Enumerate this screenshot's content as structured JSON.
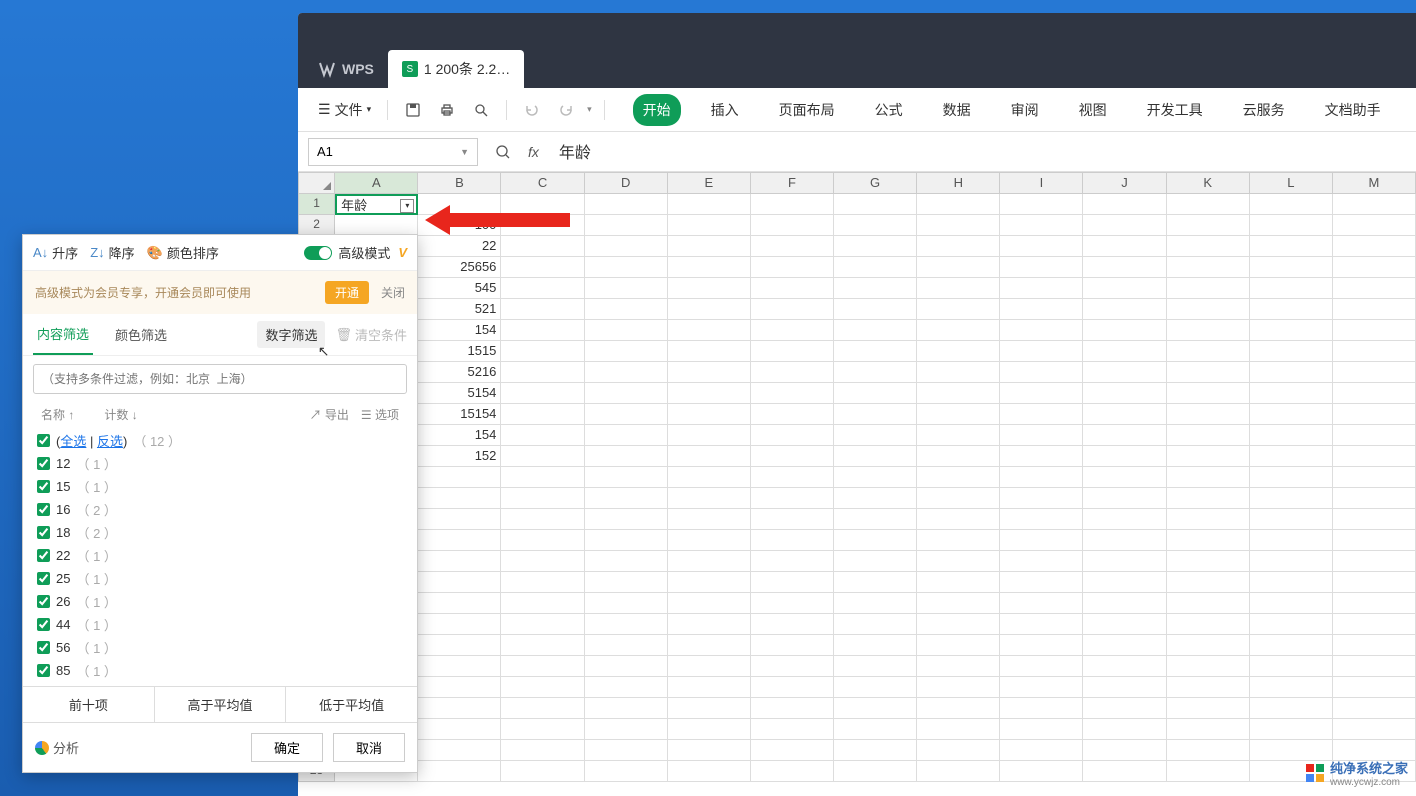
{
  "tabs": {
    "wps": "WPS",
    "active_doc": "1 200条 2.2…",
    "active_icon": "S"
  },
  "ribbon": {
    "file": "文件",
    "tabs": [
      "开始",
      "插入",
      "页面布局",
      "公式",
      "数据",
      "审阅",
      "视图",
      "开发工具",
      "云服务",
      "文档助手"
    ]
  },
  "namebox": "A1",
  "formula": "年龄",
  "columns": [
    "A",
    "B",
    "C",
    "D",
    "E",
    "F",
    "G",
    "H",
    "I",
    "J",
    "K",
    "L",
    "M"
  ],
  "sheet": {
    "a1": "年龄",
    "colB": [
      "100",
      "22",
      "25656",
      "545",
      "521",
      "154",
      "1515",
      "5216",
      "5154",
      "15154",
      "154",
      "152"
    ]
  },
  "filter": {
    "sort_asc": "升序",
    "sort_desc": "降序",
    "sort_color": "颜色排序",
    "adv_mode": "高级模式",
    "promo": "高级模式为会员专享，开通会员即可使用",
    "promo_open": "开通",
    "promo_close": "关闭",
    "tab_content": "内容筛选",
    "tab_color": "颜色筛选",
    "num_filter": "数字筛选",
    "clear": "清空条件",
    "search_ph": "（支持多条件过滤，例如：北京  上海）",
    "col_name": "名称",
    "col_count": "计数",
    "export": "导出",
    "options": "选项",
    "select_all": "全选",
    "invert": "反选",
    "all_count": "（ 12 ）",
    "items": [
      {
        "v": "12",
        "c": "（ 1 ）"
      },
      {
        "v": "15",
        "c": "（ 1 ）"
      },
      {
        "v": "16",
        "c": "（ 2 ）"
      },
      {
        "v": "18",
        "c": "（ 2 ）"
      },
      {
        "v": "22",
        "c": "（ 1 ）"
      },
      {
        "v": "25",
        "c": "（ 1 ）"
      },
      {
        "v": "26",
        "c": "（ 1 ）"
      },
      {
        "v": "44",
        "c": "（ 1 ）"
      },
      {
        "v": "56",
        "c": "（ 1 ）"
      },
      {
        "v": "85",
        "c": "（ 1 ）"
      }
    ],
    "top10": "前十项",
    "above_avg": "高于平均值",
    "below_avg": "低于平均值",
    "analyze": "分析",
    "ok": "确定",
    "cancel": "取消"
  },
  "watermark": {
    "title": "纯净系统之家",
    "url": "www.ycwjz.com"
  }
}
